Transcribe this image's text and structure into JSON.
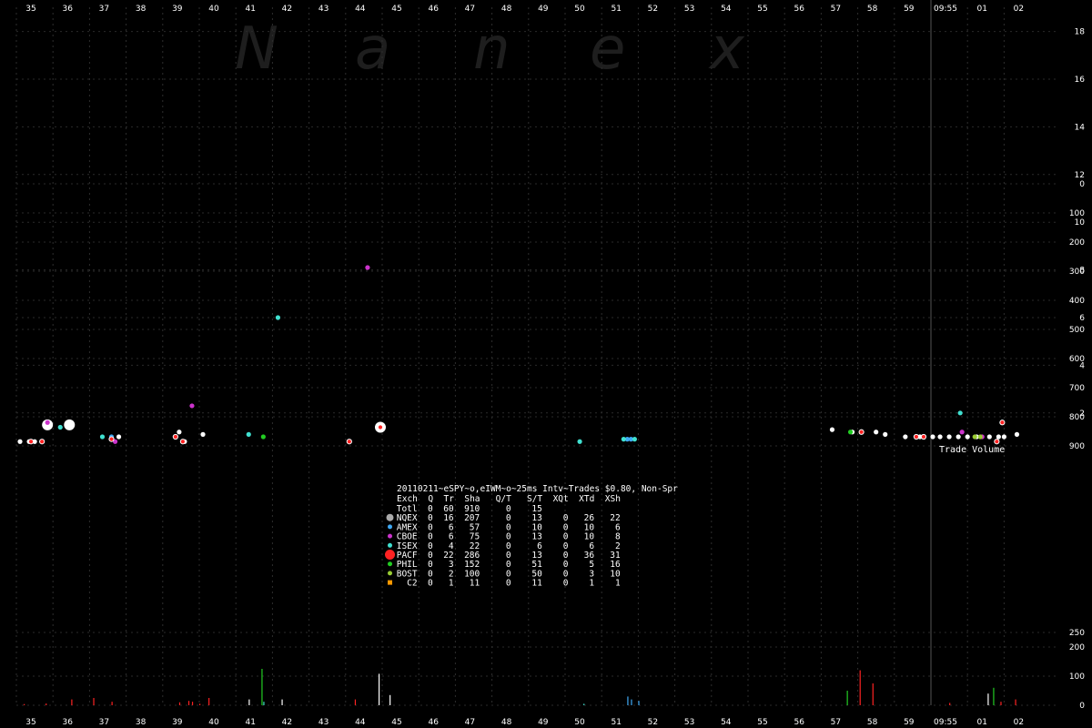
{
  "watermark": [
    "N",
    "a",
    "n",
    "e",
    "x"
  ],
  "chart_data": {
    "type": "scatter",
    "x_ticks": [
      "35",
      "36",
      "37",
      "38",
      "39",
      "40",
      "41",
      "42",
      "43",
      "44",
      "45",
      "46",
      "47",
      "48",
      "49",
      "50",
      "51",
      "52",
      "53",
      "54",
      "55",
      "56",
      "57",
      "58",
      "59",
      "09:55",
      "01",
      "02"
    ],
    "price_axis": {
      "ylim": [
        0,
        18
      ],
      "tick_labels": [
        "2",
        "4",
        "6",
        "8",
        "10",
        "12",
        "14",
        "16",
        "18"
      ]
    },
    "volume_axis_upper": {
      "ylim": [
        900,
        0
      ],
      "tick_labels": [
        "900",
        "800",
        "700",
        "600",
        "500",
        "400",
        "300",
        "200",
        "100",
        "0"
      ]
    },
    "volume_axis_lower": {
      "ylim": [
        0,
        250
      ],
      "tick_labels": [
        "0",
        "100",
        "200",
        "250"
      ]
    },
    "annotation": "Trade Volume",
    "series": [
      {
        "exchange": "NQEX",
        "color": "#ffffff",
        "points": [
          [
            35.1,
            0.8
          ],
          [
            35.35,
            0.8
          ],
          [
            35.5,
            0.8
          ],
          [
            35.85,
            1.5
          ],
          [
            36.45,
            1.5
          ],
          [
            37.8,
            1.0
          ],
          [
            39.35,
            1.0
          ],
          [
            39.45,
            1.2
          ],
          [
            39.6,
            0.8
          ],
          [
            40.1,
            1.1
          ],
          [
            44.1,
            0.8
          ],
          [
            44.95,
            1.4
          ],
          [
            57.3,
            1.3
          ],
          [
            57.85,
            1.2
          ],
          [
            58.1,
            1.2
          ],
          [
            58.5,
            1.2
          ],
          [
            58.75,
            1.1
          ],
          [
            59.3,
            1.0
          ],
          [
            59.7,
            1.0
          ],
          [
            60.05,
            1.0
          ],
          [
            60.25,
            1.0
          ],
          [
            60.5,
            1.0
          ],
          [
            60.75,
            1.0
          ],
          [
            61.0,
            1.0
          ],
          [
            61.25,
            1.0
          ],
          [
            61.6,
            1.0
          ],
          [
            61.85,
            1.0
          ],
          [
            62.0,
            1.0
          ],
          [
            62.35,
            1.1
          ]
        ]
      },
      {
        "exchange": "AMEX",
        "color": "#3fa9f5",
        "points": [
          [
            37.6,
            1.0
          ],
          [
            51.7,
            0.9
          ],
          [
            51.8,
            0.9
          ]
        ]
      },
      {
        "exchange": "CBOE",
        "color": "#cc33cc",
        "points": [
          [
            35.85,
            1.6
          ],
          [
            37.7,
            0.8
          ],
          [
            39.8,
            2.3
          ],
          [
            44.6,
            8.1
          ],
          [
            60.85,
            1.2
          ],
          [
            61.4,
            1.0
          ]
        ]
      },
      {
        "exchange": "ISEX",
        "color": "#40e0d0",
        "points": [
          [
            36.2,
            1.4
          ],
          [
            37.35,
            1.0
          ],
          [
            41.35,
            1.1
          ],
          [
            42.15,
            6.0
          ],
          [
            50.4,
            0.8
          ],
          [
            51.6,
            0.9
          ],
          [
            51.9,
            0.9
          ],
          [
            60.8,
            2.0
          ]
        ]
      },
      {
        "exchange": "PACF",
        "color": "#ff2222",
        "points": [
          [
            35.4,
            0.8
          ],
          [
            35.7,
            0.8
          ],
          [
            37.6,
            0.9
          ],
          [
            39.35,
            1.0
          ],
          [
            39.55,
            0.8
          ],
          [
            44.1,
            0.8
          ],
          [
            44.95,
            1.4
          ],
          [
            58.1,
            1.2
          ],
          [
            59.6,
            1.0
          ],
          [
            59.8,
            1.0
          ],
          [
            61.8,
            0.8
          ],
          [
            61.95,
            1.6
          ]
        ]
      },
      {
        "exchange": "PHIL",
        "color": "#22cc22",
        "points": [
          [
            41.75,
            1.0
          ],
          [
            57.8,
            1.2
          ]
        ]
      },
      {
        "exchange": "BOST",
        "color": "#99cc33",
        "points": [
          [
            61.2,
            1.0
          ],
          [
            61.35,
            1.0
          ]
        ]
      },
      {
        "exchange": "C2",
        "color": "#ff9900",
        "points": []
      }
    ],
    "volume_bars": [
      [
        35.2,
        4,
        "#ff2222"
      ],
      [
        35.8,
        6,
        "#ff2222"
      ],
      [
        36.5,
        20,
        "#ff2222"
      ],
      [
        37.1,
        25,
        "#ff2222"
      ],
      [
        37.6,
        12,
        "#ff2222"
      ],
      [
        39.45,
        10,
        "#ff2222"
      ],
      [
        39.7,
        15,
        "#ff2222"
      ],
      [
        39.8,
        12,
        "#ff2222"
      ],
      [
        40.0,
        5,
        "#ff2222"
      ],
      [
        40.25,
        25,
        "#ff2222"
      ],
      [
        41.35,
        20,
        "#ffffff"
      ],
      [
        41.7,
        125,
        "#22cc22"
      ],
      [
        41.75,
        12,
        "#40e0d0"
      ],
      [
        42.25,
        20,
        "#ffffff"
      ],
      [
        44.25,
        20,
        "#ff2222"
      ],
      [
        44.9,
        108,
        "#ffffff"
      ],
      [
        45.2,
        35,
        "#ffffff"
      ],
      [
        50.5,
        5,
        "#40e0d0"
      ],
      [
        51.7,
        30,
        "#3fa9f5"
      ],
      [
        51.8,
        20,
        "#3fa9f5"
      ],
      [
        52.0,
        15,
        "#3fa9f5"
      ],
      [
        57.7,
        50,
        "#22cc22"
      ],
      [
        58.05,
        120,
        "#ff2222"
      ],
      [
        58.4,
        75,
        "#ff2222"
      ],
      [
        60.5,
        8,
        "#ff2222"
      ],
      [
        61.55,
        40,
        "#ffffff"
      ],
      [
        61.7,
        60,
        "#22cc22"
      ],
      [
        61.9,
        12,
        "#ff2222"
      ],
      [
        62.3,
        20,
        "#ff2222"
      ]
    ]
  },
  "stats": {
    "title": "20110211~eSPY~o,eIWM~o~25ms Intv~Trades $0.80, Non-Spr",
    "header": "Exch  Q  Tr  Sha   Q/T   S/T  XQt  XTd  XSh",
    "rows": [
      {
        "label": " Totl  0  60  910     0    15",
        "color": ""
      },
      {
        "label": " NQEX  0  16  207     0    13    0   26   22",
        "color": "#aaaaaa"
      },
      {
        "label": " AMEX  0   6   57     0    10    0   10    6",
        "color": "#3fa9f5"
      },
      {
        "label": " CBOE  0   6   75     0    13    0   10    8",
        "color": "#cc33cc"
      },
      {
        "label": " ISEX  0   4   22     0     6    0    6    2",
        "color": "#40e0d0"
      },
      {
        "label": " PACF  0  22  286     0    13    0   36   31",
        "color": "#ff2222"
      },
      {
        "label": " PHIL  0   3  152     0    51    0    5   16",
        "color": "#22cc22"
      },
      {
        "label": " BOST  0   2  100     0    50    0    3   10",
        "color": "#99cc33"
      },
      {
        "label": "   C2  0   1   11     0    11    0    1    1",
        "color": "#ff9900"
      }
    ]
  }
}
